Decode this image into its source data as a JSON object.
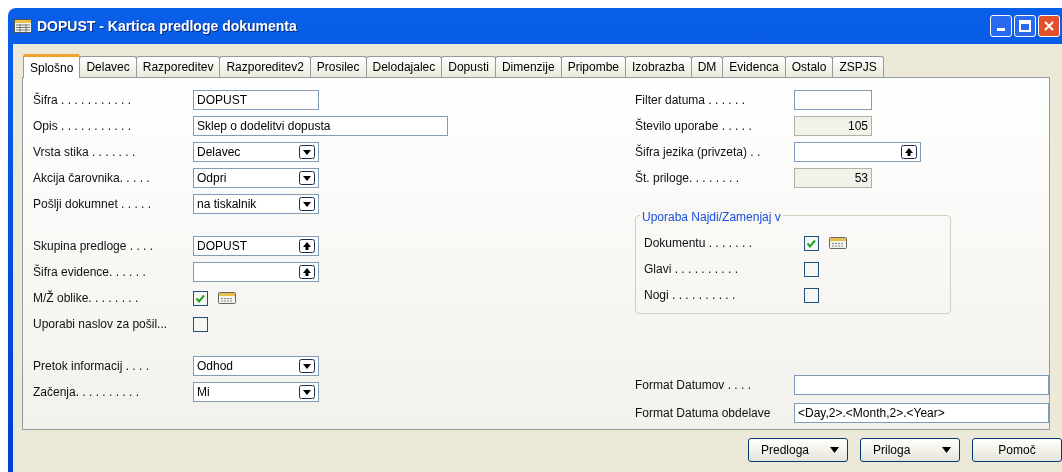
{
  "window": {
    "title": "DOPUST - Kartica predloge dokumenta"
  },
  "tabs": [
    {
      "label": "Splošno",
      "selected": true
    },
    {
      "label": "Delavec",
      "selected": false
    },
    {
      "label": "Razporeditev",
      "selected": false
    },
    {
      "label": "Razporeditev2",
      "selected": false
    },
    {
      "label": "Prosilec",
      "selected": false
    },
    {
      "label": "Delodajalec",
      "selected": false
    },
    {
      "label": "Dopusti",
      "selected": false
    },
    {
      "label": "Dimenzije",
      "selected": false
    },
    {
      "label": "Pripombe",
      "selected": false
    },
    {
      "label": "Izobrazba",
      "selected": false
    },
    {
      "label": "DM",
      "selected": false
    },
    {
      "label": "Evidenca",
      "selected": false
    },
    {
      "label": "Ostalo",
      "selected": false
    },
    {
      "label": "ZSPJS",
      "selected": false
    }
  ],
  "left_sections": [
    [
      {
        "kind": "text",
        "label": "Šifra . . . . . . . . . . .",
        "value": "DOPUST"
      },
      {
        "kind": "text_wide",
        "label": "Opis . . . . . . . . . . .",
        "value": "Sklep o dodelitvi dopusta"
      },
      {
        "kind": "dropdown",
        "label": "Vrsta stika . . . . . . .",
        "value": "Delavec"
      },
      {
        "kind": "dropdown",
        "label": "Akcija čarovnika. . . . .",
        "value": "Odpri"
      },
      {
        "kind": "dropdown",
        "label": "Pošlji dokumnet . . . . .",
        "value": "na tiskalnik"
      }
    ],
    [
      {
        "kind": "lookup",
        "label": "Skupina predloge . . . .",
        "value": "DOPUST"
      },
      {
        "kind": "lookup",
        "label": "Šifra evidence. . . . . ."
      },
      {
        "kind": "checkbox_assist",
        "label": "M/Ž oblike. . . . . . . .",
        "checked": true
      },
      {
        "kind": "checkbox",
        "label": "Uporabi naslov za pošil...",
        "checked": false
      }
    ],
    [
      {
        "kind": "dropdown",
        "label": "Pretok informacij . . . .",
        "value": "Odhod"
      },
      {
        "kind": "dropdown",
        "label": "Začenja. . . . . . . . . .",
        "value": "Mi"
      }
    ]
  ],
  "right_fields": [
    {
      "kind": "text",
      "label": "Filter datuma . . . . . ."
    },
    {
      "kind": "readonly",
      "label": "Število uporabe . . . . .",
      "value": "105"
    },
    {
      "kind": "lookup",
      "label": "Šifra jezika (privzeta) . ."
    },
    {
      "kind": "readonly",
      "label": "Št. priloge. . . . . . . .",
      "value": "53"
    }
  ],
  "group": {
    "title": "Uporaba Najdi/Zamenjaj v",
    "fields": [
      {
        "kind": "checkbox_assist",
        "label": "Dokumentu . . . . . . .",
        "checked": true
      },
      {
        "kind": "checkbox",
        "label": "Glavi . . . . . . . . . .",
        "checked": false
      },
      {
        "kind": "checkbox",
        "label": "Nogi . . . . . . . . . .",
        "checked": false
      }
    ]
  },
  "bottom_fields": [
    {
      "kind": "text_wide",
      "label": "Format Datumov . . . ."
    },
    {
      "kind": "text_wide",
      "label": "Format Datuma obdelave",
      "value": "<Day,2>.<Month,2>.<Year>"
    }
  ],
  "buttons": [
    {
      "label": "Predloga",
      "menu": true
    },
    {
      "label": "Priloga",
      "menu": true
    },
    {
      "label": "Pomoč",
      "menu": false
    }
  ]
}
